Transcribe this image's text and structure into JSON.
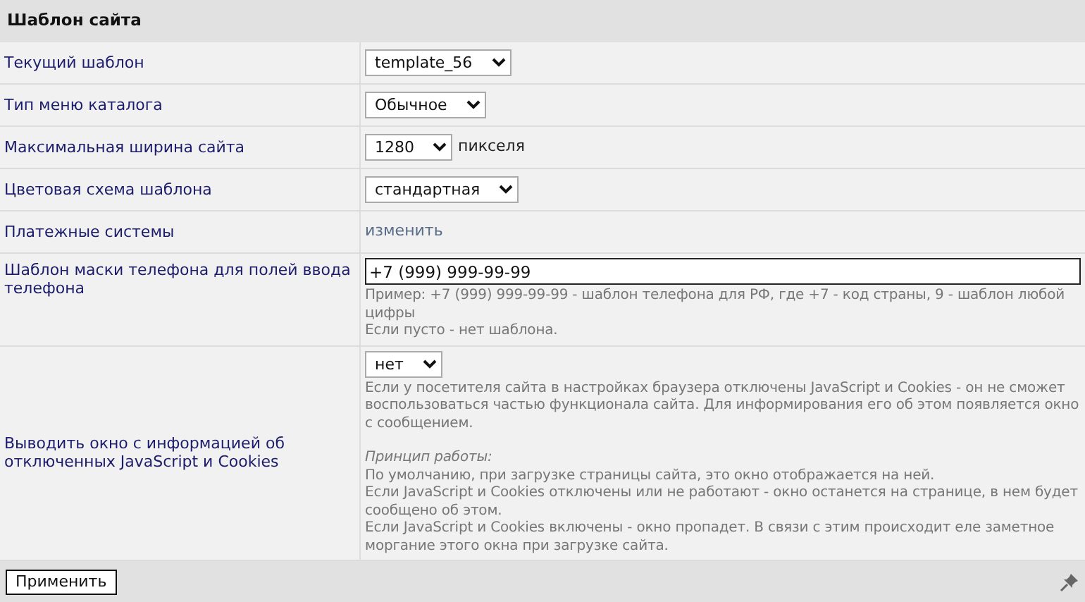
{
  "section_title": "Шаблон сайта",
  "rows": [
    {
      "kind": "select",
      "label": "Текущий шаблон",
      "value": "template_56"
    },
    {
      "kind": "select",
      "label": "Тип меню каталога",
      "value": "Обычное"
    },
    {
      "kind": "select",
      "label": "Максимальная ширина сайта",
      "value": "1280",
      "suffix": "пикселя"
    },
    {
      "kind": "select",
      "label": "Цветовая схема шаблона",
      "value": "стандартная"
    },
    {
      "kind": "link",
      "label": "Платежные системы",
      "link": "изменить"
    },
    {
      "kind": "input",
      "label": "Шаблон маски телефона для полей ввода телефона",
      "value": "+7 (999) 999-99-99",
      "notes": [
        {
          "kind": "line",
          "text": "Пример: +7 (999) 999-99-99 - шаблон телефона для РФ, где +7 - код страны, 9 - шаблон любой цифры"
        },
        {
          "kind": "line",
          "text": "Если пусто - нет шаблона."
        }
      ]
    },
    {
      "kind": "select",
      "label": "Выводить окно с информацией об отключенных JavaScript и Cookies",
      "value": "нет",
      "notes": [
        {
          "kind": "paragraph",
          "text": "Если у посетителя сайта в настройках браузера отключены JavaScript и Cookies - он не сможет воспользоваться частью функционала сайта. Для информирования его об этом появляется окно с сообщением."
        },
        {
          "kind": "heading",
          "text": "Принцип работы:"
        },
        {
          "kind": "line",
          "text": "По умолчанию, при загрузке страницы сайта, это окно отображается на ней."
        },
        {
          "kind": "line",
          "text": "Если JavaScript и Cookies отключены или не работают - окно останется на странице, в нем будет сообщено об этом."
        },
        {
          "kind": "line",
          "text": "Если JavaScript и Cookies включены - окно пропадет. В связи с этим происходит еле заметное моргание этого окна при загрузке сайта."
        }
      ]
    }
  ],
  "apply_button": "Применить"
}
